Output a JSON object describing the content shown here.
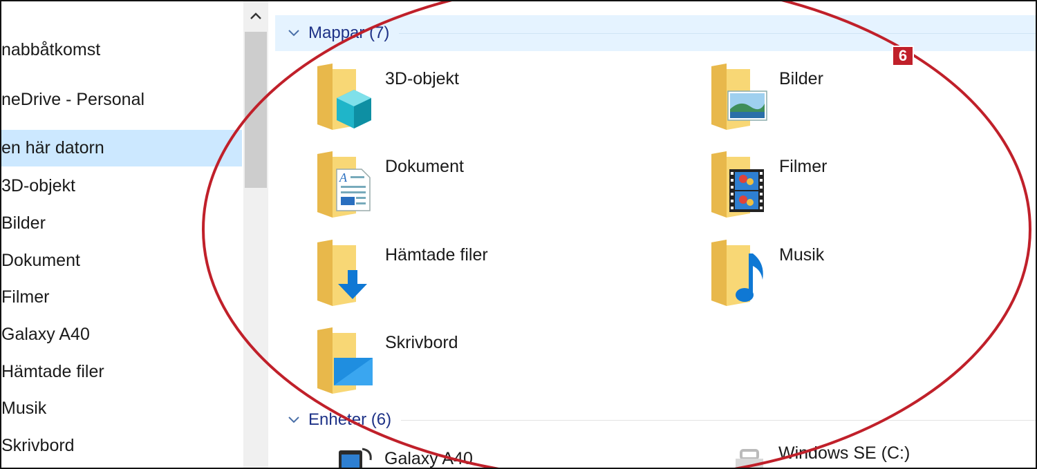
{
  "sidebar": {
    "items": [
      {
        "label": "nabbåtkomst",
        "selected": false
      },
      {
        "label": "neDrive - Personal",
        "selected": false
      },
      {
        "label": "en här datorn",
        "selected": true
      },
      {
        "label": "3D-objekt",
        "selected": false
      },
      {
        "label": "Bilder",
        "selected": false
      },
      {
        "label": "Dokument",
        "selected": false
      },
      {
        "label": "Filmer",
        "selected": false
      },
      {
        "label": "Galaxy A40",
        "selected": false
      },
      {
        "label": "Hämtade filer",
        "selected": false
      },
      {
        "label": "Musik",
        "selected": false
      },
      {
        "label": "Skrivbord",
        "selected": false
      }
    ]
  },
  "scrollbar": {
    "up_icon": "chevron-up-icon"
  },
  "main": {
    "folders_group": {
      "label": "Mappar (7)",
      "icon": "chevron-down-icon"
    },
    "folders": [
      {
        "label": "3D-objekt",
        "icon": "folder-3d-icon"
      },
      {
        "label": "Bilder",
        "icon": "folder-pictures-icon"
      },
      {
        "label": "Dokument",
        "icon": "folder-documents-icon"
      },
      {
        "label": "Filmer",
        "icon": "folder-videos-icon"
      },
      {
        "label": "Hämtade filer",
        "icon": "folder-downloads-icon"
      },
      {
        "label": "Musik",
        "icon": "folder-music-icon"
      },
      {
        "label": "Skrivbord",
        "icon": "folder-desktop-icon"
      }
    ],
    "devices_group": {
      "label": "Enheter (6)",
      "icon": "chevron-down-icon"
    },
    "devices": [
      {
        "label": "Galaxy A40",
        "icon": "phone-icon"
      },
      {
        "label": "Windows SE (C:)",
        "icon": "drive-icon"
      }
    ]
  },
  "annotation": {
    "badge": "6",
    "color": "#c0202a"
  },
  "colors": {
    "selected": "#cce8ff",
    "group_header": "#e5f3ff",
    "group_text": "#1e3287",
    "folder": "#f8d775",
    "folder_dark": "#e8b84b",
    "accent_blue": "#0f78d4"
  }
}
